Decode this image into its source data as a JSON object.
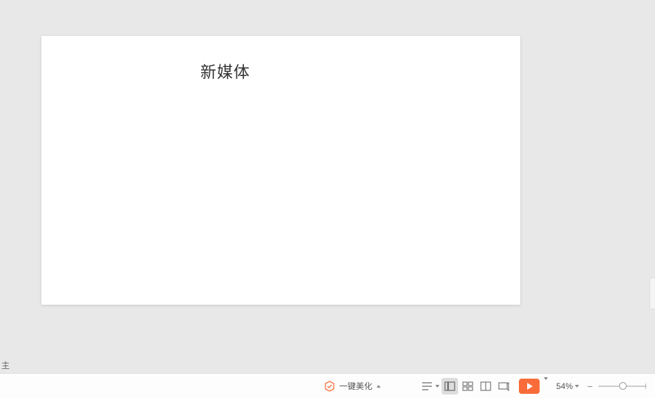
{
  "slide": {
    "text": "新媒体"
  },
  "status": {
    "left_fragment": "主"
  },
  "toolbar": {
    "beautify_label": "一键美化",
    "zoom_label": "54%",
    "zoom_minus": "−"
  }
}
